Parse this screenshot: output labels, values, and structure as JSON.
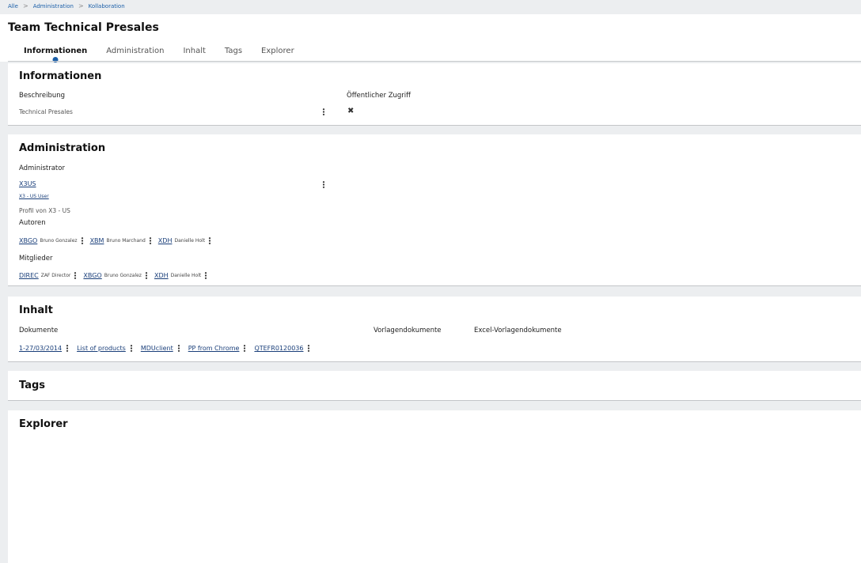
{
  "breadcrumb": {
    "items": [
      "Alle",
      "Administration",
      "Kollaboration"
    ],
    "separator": ">"
  },
  "page": {
    "title": "Team Technical Presales"
  },
  "tabs": [
    {
      "label": "Informationen",
      "active": true
    },
    {
      "label": "Administration",
      "active": false
    },
    {
      "label": "Inhalt",
      "active": false
    },
    {
      "label": "Tags",
      "active": false
    },
    {
      "label": "Explorer",
      "active": false
    }
  ],
  "info": {
    "title": "Informationen",
    "desc_label": "Beschreibung",
    "desc_value": "Technical Presales",
    "public_label": "Öffentlicher Zugriff",
    "public_value_icon": "x-icon",
    "public_value_glyph": "✖"
  },
  "admin": {
    "title": "Administration",
    "administrator_label": "Administrator",
    "administrator_code": "X3US",
    "administrator_name": "X3 - US User",
    "administrator_profile": "Profil von X3 - US",
    "authors_label": "Autoren",
    "authors": [
      {
        "code": "XBGO",
        "name": "Bruno Gonzalez"
      },
      {
        "code": "XBM",
        "name": "Bruno Marchand"
      },
      {
        "code": "XDH",
        "name": "Danielle Holt"
      }
    ],
    "members_label": "Mitglieder",
    "members": [
      {
        "code": "DIREC",
        "name": "ZAF Director"
      },
      {
        "code": "XBGO",
        "name": "Bruno Gonzalez"
      },
      {
        "code": "XDH",
        "name": "Danielle Holt"
      }
    ]
  },
  "content": {
    "title": "Inhalt",
    "documents_label": "Dokumente",
    "template_docs_label": "Vorlagendokumente",
    "excel_template_docs_label": "Excel-Vorlagendokumente",
    "documents": [
      "1-27/03/2014",
      "List of products",
      "MDUclient",
      "PP from Chrome",
      "QTEFR0120036"
    ]
  },
  "tags": {
    "title": "Tags"
  },
  "explorer": {
    "title": "Explorer"
  },
  "colors": {
    "accent": "#1a5ea8",
    "background": "#eceef0",
    "link": "#1a3f7a"
  }
}
